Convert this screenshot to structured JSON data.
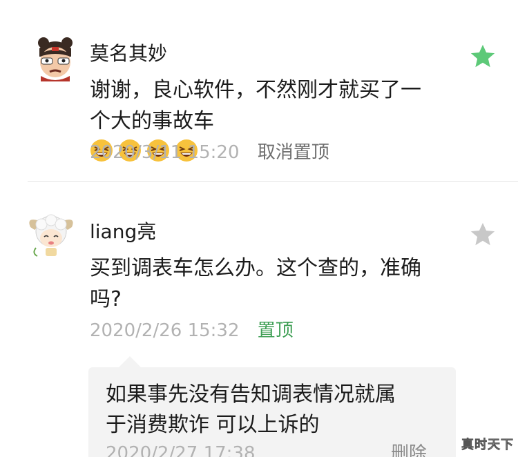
{
  "comments": [
    {
      "username": "莫名其妙",
      "text": "谢谢，良心软件，不然刚才就买了一\n个大的事故车",
      "emoji": [
        "laughing-crying-emoji",
        "laughing-crying-emoji",
        "laughing-crying-emoji",
        "laughing-crying-emoji"
      ],
      "timestamp": "2020/3/11 15:20",
      "action": "取消置顶",
      "starred": true,
      "avatar": "cartoon-boy-avatar"
    },
    {
      "username": "liang亮",
      "text": "买到调表车怎么办。这个查的，准确\n吗?",
      "timestamp": "2020/2/26 15:32",
      "action": "置顶",
      "starred": false,
      "avatar": "cartoon-sheep-avatar",
      "reply": {
        "text": "如果事先没有告知调表情况就属\n于消费欺诈 可以上诉的",
        "timestamp": "2020/2/27 17:38",
        "delete_label": "删除"
      }
    }
  ],
  "colors": {
    "star_active": "#5dc978",
    "star_inactive": "#c8c8c8",
    "pin_action": "#3f9f55",
    "timestamp": "#b2b2b2"
  },
  "watermark": "真时天下"
}
